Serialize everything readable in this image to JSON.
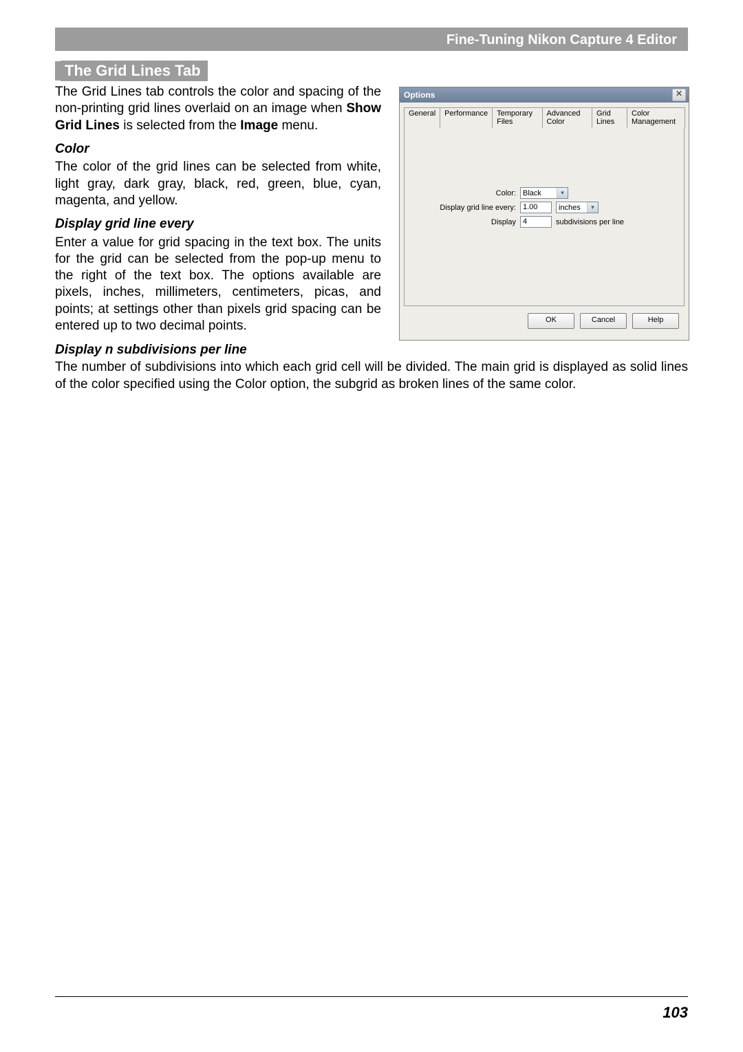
{
  "header": {
    "title": "Fine-Tuning Nikon Capture 4 Editor"
  },
  "section": {
    "title": "The Grid Lines Tab"
  },
  "text": {
    "intro_a": "The Grid Lines tab controls the color and spacing of the non-printing grid lines overlaid on an image when ",
    "intro_bold1": "Show Grid Lines",
    "intro_b": " is selected from the ",
    "intro_bold2": "Image",
    "intro_c": " menu.",
    "color_h": "Color",
    "color_p": "The color of the grid lines can be selected from white, light gray, dark gray, black, red, green, blue, cyan, magenta, and yellow.",
    "every_h": "Display grid line every",
    "every_p": "Enter a value for grid spacing in the text box. The units for the grid can be selected from the pop-up menu to the right of the text box.  The options available are pixels, inches, millimeters, centimeters, picas, and points; at settings other than pixels grid spacing can be entered up to two decimal points.",
    "sub_h": "Display n subdivisions per line",
    "sub_p": "The number of subdivisions into which each grid cell will be divided.  The main grid is displayed as solid lines of the color specified using the Color option, the subgrid as broken lines of the same color."
  },
  "dialog": {
    "title": "Options",
    "tabs": [
      "General",
      "Performance",
      "Temporary Files",
      "Advanced Color",
      "Grid Lines",
      "Color Management"
    ],
    "active_tab": "Grid Lines",
    "labels": {
      "color": "Color:",
      "every": "Display grid line every:",
      "display": "Display",
      "sub_after": "subdivisions per line"
    },
    "values": {
      "color": "Black",
      "spacing": "1.00",
      "unit": "inches",
      "subdiv": "4"
    },
    "buttons": {
      "ok": "OK",
      "cancel": "Cancel",
      "help": "Help"
    }
  },
  "page_number": "103"
}
